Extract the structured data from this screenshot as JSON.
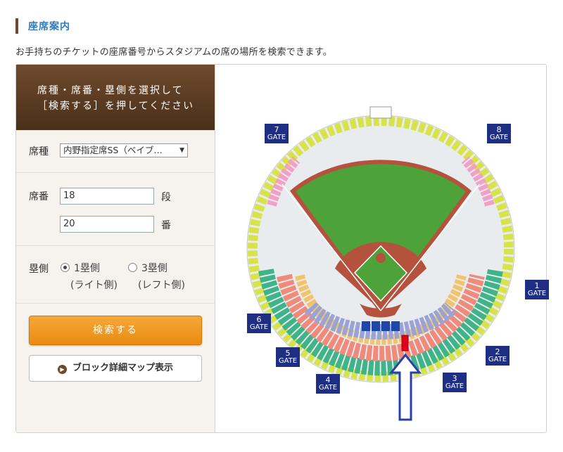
{
  "page": {
    "section_title": "座席案内",
    "intro": "お手持ちのチケットの座席番号からスタジアムの席の場所を検索できます。"
  },
  "form": {
    "instruction_line1": "席種・席番・塁側を選択して",
    "instruction_line2": "［検索する］を押してください",
    "seat_type_label": "席種",
    "seat_type_value": "内野指定席SS（ベイブ…",
    "seat_no_label": "席番",
    "row_value": "18",
    "row_unit": "段",
    "num_value": "20",
    "num_unit": "番",
    "side_label": "塁側",
    "side_option1": "1塁側",
    "side_option1_sub": "(ライト側)",
    "side_option2": "3塁側",
    "side_option2_sub": "(レフト側)",
    "search_button": "検索する",
    "map_button": "ブロック詳細マップ表示"
  },
  "map": {
    "gates": [
      {
        "num": "1",
        "label": "GATE"
      },
      {
        "num": "2",
        "label": "GATE"
      },
      {
        "num": "3",
        "label": "GATE"
      },
      {
        "num": "4",
        "label": "GATE"
      },
      {
        "num": "5",
        "label": "GATE"
      },
      {
        "num": "6",
        "label": "GATE"
      },
      {
        "num": "7",
        "label": "GATE"
      },
      {
        "num": "8",
        "label": "GATE"
      }
    ],
    "colors": {
      "field_green": "#4ea23a",
      "dirt": "#b5523d",
      "highlight_seat": "#e0001b",
      "arrow": "#2b3fa8",
      "gate_bg": "#1e2e83"
    }
  }
}
